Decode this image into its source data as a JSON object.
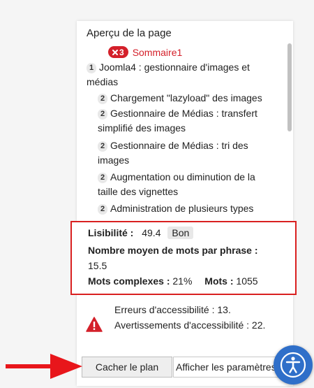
{
  "outline": {
    "title": "Aperçu de la page",
    "error_badge": {
      "icon": "close-x-icon",
      "count": "3"
    },
    "error_label": "Sommaire1",
    "headings": [
      {
        "level": "1",
        "line1": "Joomla4 : gestionnaire d'images et",
        "line2": "médias"
      },
      {
        "level": "2",
        "line1": "Chargement \"lazyload\" des images",
        "line2": ""
      },
      {
        "level": "2",
        "line1": "Gestionnaire de Médias : transfert",
        "line2": "simplifié des images"
      },
      {
        "level": "2",
        "line1": "Gestionnaire de Médias : tri des",
        "line2": "images"
      },
      {
        "level": "2",
        "line1": "Augmentation ou diminution de la",
        "line2": "taille des vignettes"
      },
      {
        "level": "2",
        "line1": "Administration de plusieurs types",
        "line2": ""
      }
    ]
  },
  "readability": {
    "label": "Lisibilité :",
    "score": "49.4",
    "rating": "Bon",
    "avg_words_label": "Nombre moyen de mots par phrase :",
    "avg_words_value": "15.5",
    "complex_label": "Mots complexes :",
    "complex_value": "21%",
    "words_label": "Mots :",
    "words_value": "1055"
  },
  "accessibility": {
    "icon": "warning-triangle-icon",
    "errors_line": "Erreurs d'accessibilité : 13.",
    "warnings_line": "Avertissements d'accessibilité : 22."
  },
  "buttons": {
    "hide_outline": "Cacher le plan",
    "show_params": "Afficher les paramètres"
  },
  "colors": {
    "error_red": "#d4202a",
    "accent_blue": "#2f6fc9",
    "highlight_border": "#d92020"
  }
}
